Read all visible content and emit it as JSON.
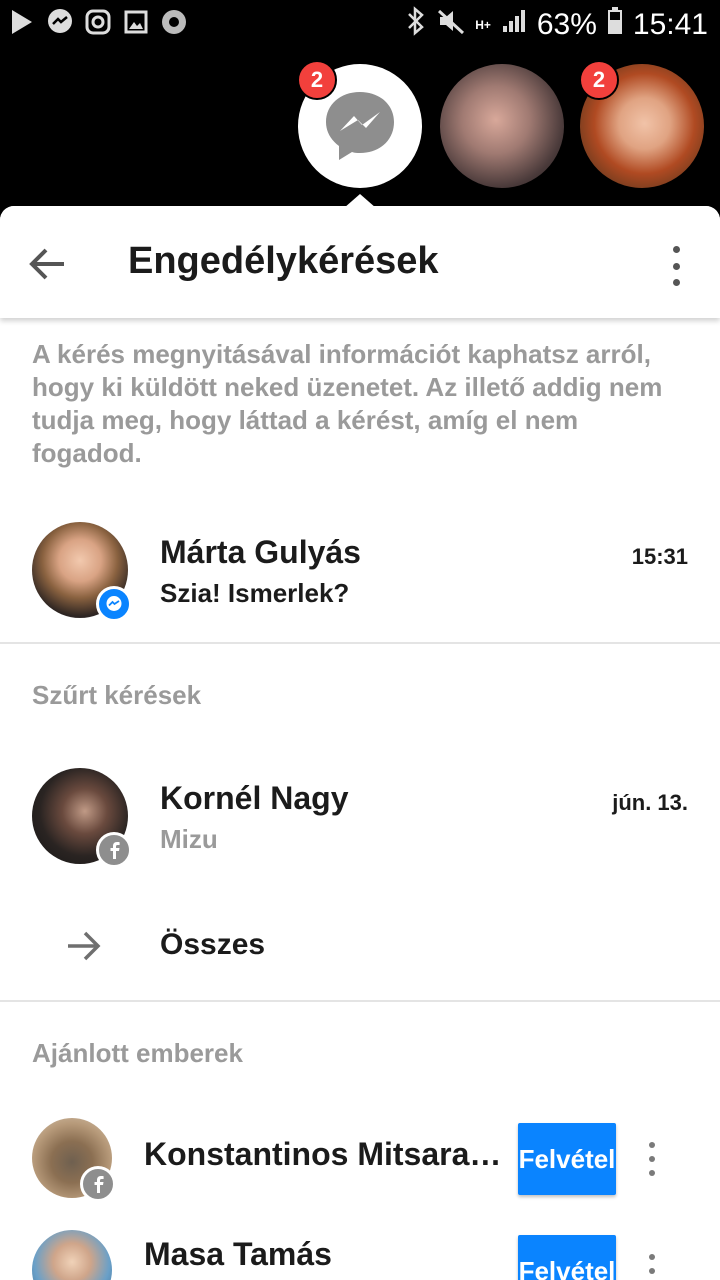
{
  "status_bar": {
    "battery": "63%",
    "time": "15:41",
    "network": "H+"
  },
  "chat_heads": [
    {
      "name": "messenger",
      "badge": "2"
    },
    {
      "name": "contact-1",
      "badge": ""
    },
    {
      "name": "contact-2",
      "badge": "2"
    }
  ],
  "header": {
    "title": "Engedélykérések"
  },
  "info_text": "A kérés megnyitásával információt kaphatsz arról, hogy ki küldött neked üzenetet. Az illető addig nem tudja meg, hogy láttad a kérést, amíg el nem fogadod.",
  "requests": [
    {
      "name": "Márta Gulyás",
      "message": "Szia!  Ismerlek?",
      "time": "15:31",
      "source_icon": "messenger-icon"
    }
  ],
  "filtered": {
    "section_title": "Szűrt kérések",
    "items": [
      {
        "name": "Kornél Nagy",
        "message": "Mizu",
        "time": "jún. 13.",
        "source_icon": "facebook-icon"
      }
    ],
    "all_label": "Összes"
  },
  "suggested": {
    "section_title": "Ajánlott emberek",
    "people": [
      {
        "name": "Konstantinos Mitsara…",
        "button": "Felvétel"
      },
      {
        "name": "Masa Tamás",
        "button": "Felvétel"
      }
    ]
  },
  "colors": {
    "accent": "#0a84ff",
    "badge": "#f2403c",
    "muted_text": "#9a9a9a"
  }
}
